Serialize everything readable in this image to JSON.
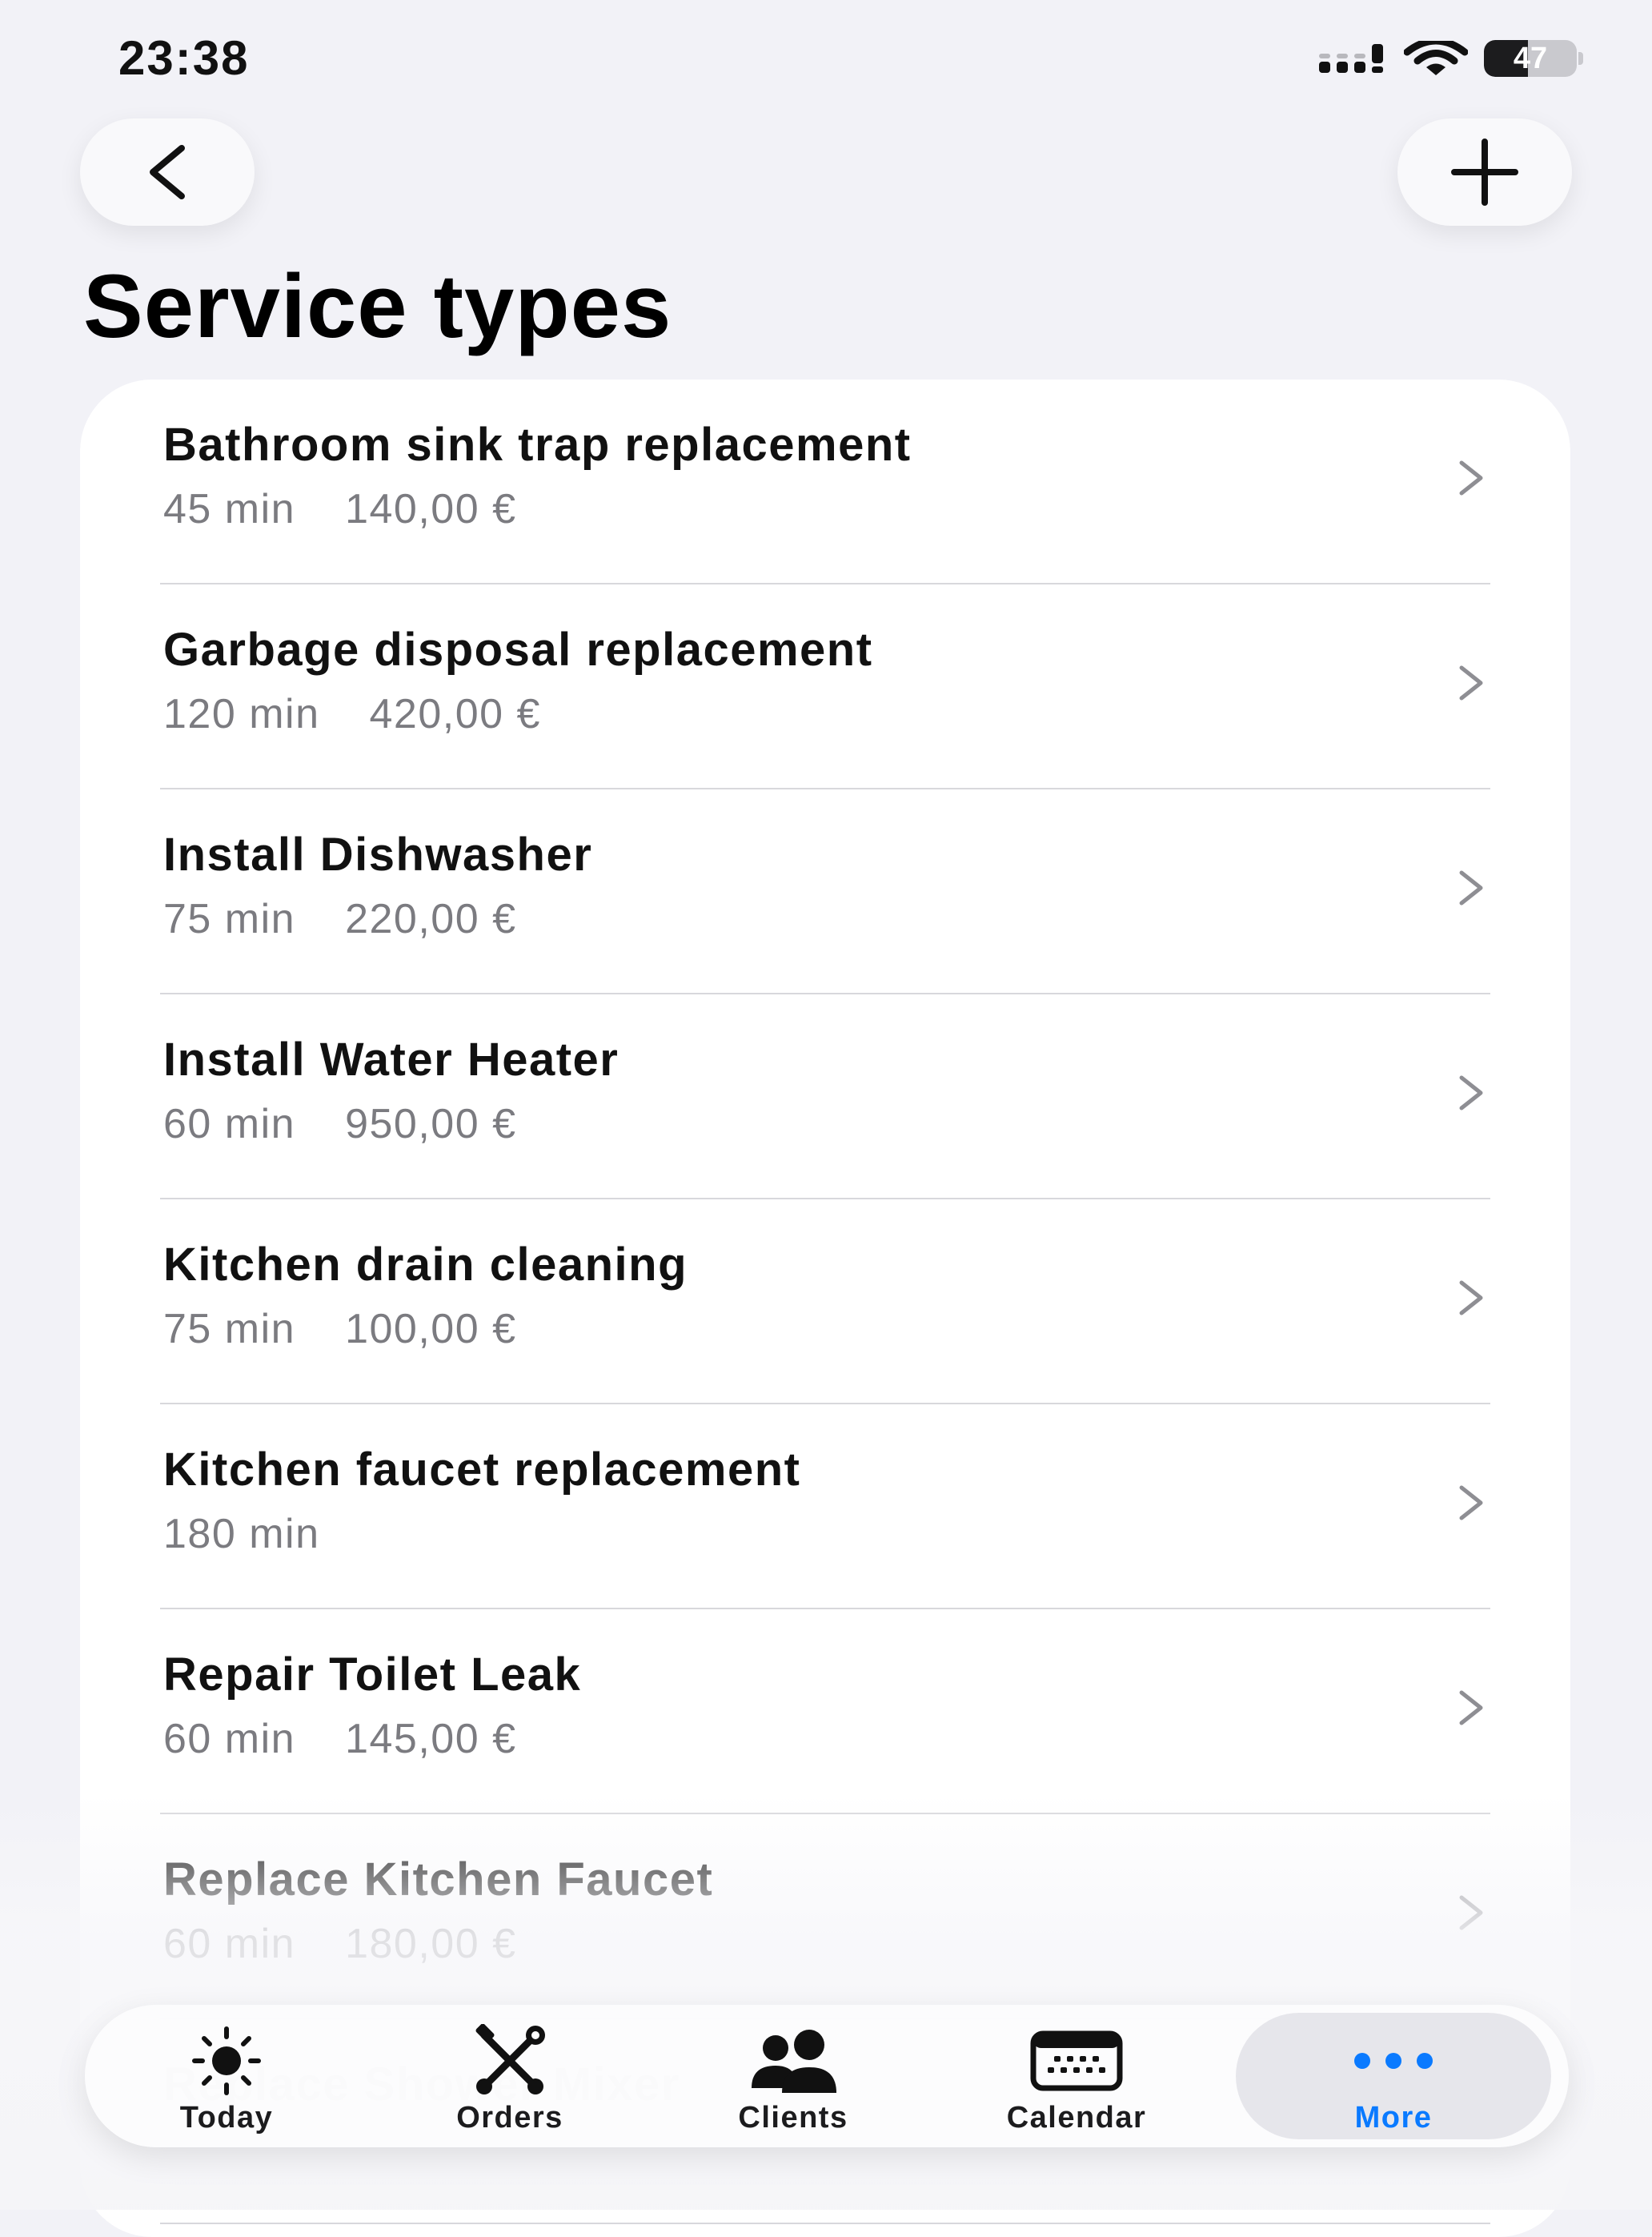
{
  "status_bar": {
    "time": "23:38",
    "battery_level": "47",
    "signal_icon": "cellular-signal-icon",
    "wifi_icon": "wifi-icon",
    "battery_icon": "battery-icon"
  },
  "nav": {
    "back_icon": "chevron-left-icon",
    "add_icon": "plus-icon"
  },
  "page": {
    "title": "Service types"
  },
  "services": [
    {
      "name": "Bathroom sink trap replacement",
      "duration": "45 min",
      "price": "140,00 €"
    },
    {
      "name": "Garbage disposal replacement",
      "duration": "120 min",
      "price": "420,00 €"
    },
    {
      "name": "Install Dishwasher",
      "duration": "75 min",
      "price": "220,00 €"
    },
    {
      "name": "Install Water Heater",
      "duration": "60 min",
      "price": "950,00 €"
    },
    {
      "name": "Kitchen drain cleaning",
      "duration": "75 min",
      "price": "100,00 €"
    },
    {
      "name": "Kitchen faucet replacement",
      "duration": "180 min",
      "price": ""
    },
    {
      "name": "Repair Toilet Leak",
      "duration": "60 min",
      "price": "145,00 €"
    },
    {
      "name": "Replace Kitchen Faucet",
      "duration": "60 min",
      "price": "180,00 €"
    },
    {
      "name": "Replace Shower Mixer",
      "duration": "",
      "price": ""
    }
  ],
  "tab_bar": {
    "tabs": [
      {
        "label": "Today",
        "icon": "sun-icon"
      },
      {
        "label": "Orders",
        "icon": "tools-icon"
      },
      {
        "label": "Clients",
        "icon": "people-icon"
      },
      {
        "label": "Calendar",
        "icon": "calendar-icon"
      },
      {
        "label": "More",
        "icon": "ellipsis-icon"
      }
    ],
    "selected": "More"
  },
  "colors": {
    "background": "#f2f2f7",
    "card": "#ffffff",
    "accent": "#0a7aff",
    "secondary_text": "#7b7b80"
  }
}
